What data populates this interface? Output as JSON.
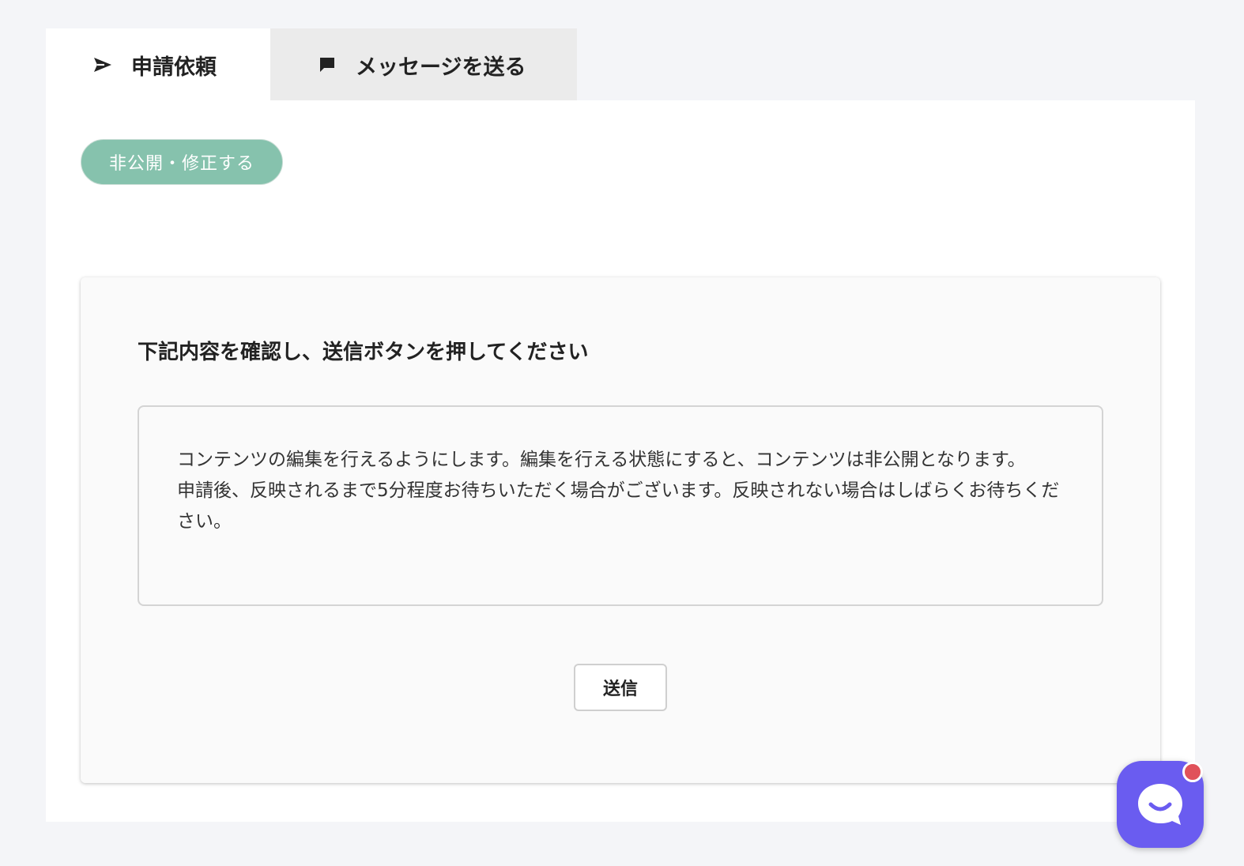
{
  "tabs": [
    {
      "label": "申請依頼",
      "icon": "paper-plane-icon",
      "active": true
    },
    {
      "label": "メッセージを送る",
      "icon": "chat-bubble-icon",
      "active": false
    }
  ],
  "status_button": {
    "label": "非公開・修正する"
  },
  "confirm": {
    "heading": "下記内容を確認し、送信ボタンを押してください",
    "notice_line1": "コンテンツの編集を行えるようにします。編集を行える状態にすると、コンテンツは非公開となります。",
    "notice_line2": "申請後、反映されるまで5分程度お待ちいただく場合がございます。反映されない場合はしばらくお待ちください。",
    "submit_label": "送信"
  },
  "colors": {
    "status_pill": "#86c2ad",
    "chat_button": "#6a5cf0",
    "notification_badge": "#e0515a"
  },
  "chat_widget": {
    "icon": "chat-smile-icon",
    "has_notification": true
  }
}
